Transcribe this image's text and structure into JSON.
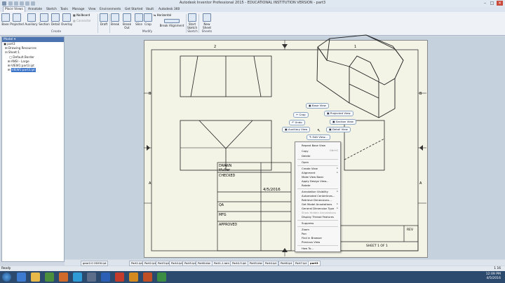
{
  "window": {
    "title": "Autodesk Inventor Professional 2015 - EDUCATIONAL INSTITUTION VERSION - part3"
  },
  "ribbon": {
    "tabs": [
      "Place Views",
      "Annotate",
      "Sketch",
      "Tools",
      "Manage",
      "View",
      "Environments",
      "Get Started",
      "Vault",
      "Autodesk 360"
    ],
    "buttons": [
      "Base",
      "Projected",
      "Auxiliary",
      "Section",
      "Detail",
      "Overlay",
      "Nailboard",
      "Connector",
      "Draft",
      "Break",
      "Break Out",
      "Slice",
      "Crop",
      "Horizontal",
      "Break Alignment",
      "Start Sketch",
      "New Sheet"
    ],
    "groups": [
      "Create",
      "Modify",
      "Sketch",
      "Sheets"
    ]
  },
  "browser": {
    "header": "Model ▾",
    "items": [
      "part3",
      "Drawing Resources",
      "Sheet:1",
      "Default Border",
      "ANSI - Large",
      "VIEW1:part3.ipt",
      "VIEW1:part3.ipt"
    ]
  },
  "drawing": {
    "zone_labels": [
      "2",
      "1",
      "B",
      "A"
    ],
    "title_block": {
      "drawn": "DRAWN",
      "drawn_by": "tfuller",
      "date": "4/5/2016",
      "checked": "CHECKED",
      "qa": "QA",
      "mfg": "MFG",
      "approved": "APPROVED",
      "rev": "REV",
      "sheet": "SHEET  1  OF  1"
    }
  },
  "marking_menu": [
    "Base View",
    "Projected View",
    "Section View",
    "Detail View",
    "Crop",
    "Undo",
    "Auxiliary View",
    "Edit View..."
  ],
  "context_menu": {
    "items": [
      {
        "label": "Repeat Base View",
        "shortcut": ""
      },
      {
        "label": "Copy",
        "shortcut": "Ctrl+C"
      },
      {
        "label": "Delete",
        "shortcut": ""
      },
      {
        "label": "Open",
        "shortcut": ""
      },
      {
        "label": "Create View",
        "shortcut": "▸"
      },
      {
        "label": "Alignment",
        "shortcut": "▸"
      },
      {
        "label": "Make View Basic",
        "shortcut": ""
      },
      {
        "label": "Apply Design View...",
        "shortcut": ""
      },
      {
        "label": "Rotate",
        "shortcut": ""
      },
      {
        "label": "Annotation Visibility",
        "shortcut": "▸"
      },
      {
        "label": "Automated Centerlines...",
        "shortcut": ""
      },
      {
        "label": "Retrieve Dimensions...",
        "shortcut": ""
      },
      {
        "label": "Get Model Annotations",
        "shortcut": "▸"
      },
      {
        "label": "General Dimension Type",
        "shortcut": "▸"
      },
      {
        "label": "Show Hidden Annotations",
        "shortcut": ""
      },
      {
        "label": "Display Thread Features",
        "shortcut": ""
      },
      {
        "label": "Suppress",
        "shortcut": ""
      },
      {
        "label": "Zoom",
        "shortcut": ""
      },
      {
        "label": "Pan",
        "shortcut": ""
      },
      {
        "label": "Find in Browser",
        "shortcut": ""
      },
      {
        "label": "Previous View",
        "shortcut": ""
      },
      {
        "label": "How To...",
        "shortcut": ""
      }
    ]
  },
  "doc_tabs": [
    "gear2.0 ODO0.ipt",
    "Part1.ipt",
    "Part2.ipt",
    "Part3.ipt",
    "Part4.ipt",
    "Part5.ipt",
    "Part6.idw",
    "Part1-1.iam",
    "Part4-3.ipt",
    "Part5.idw",
    "Part4.ipt",
    "Part6.ipt",
    "Part7.ipt",
    "part3"
  ],
  "status": {
    "left": "Ready",
    "right": "1   16"
  },
  "taskbar": {
    "time": "12:09 PM",
    "date": "4/5/2016"
  }
}
